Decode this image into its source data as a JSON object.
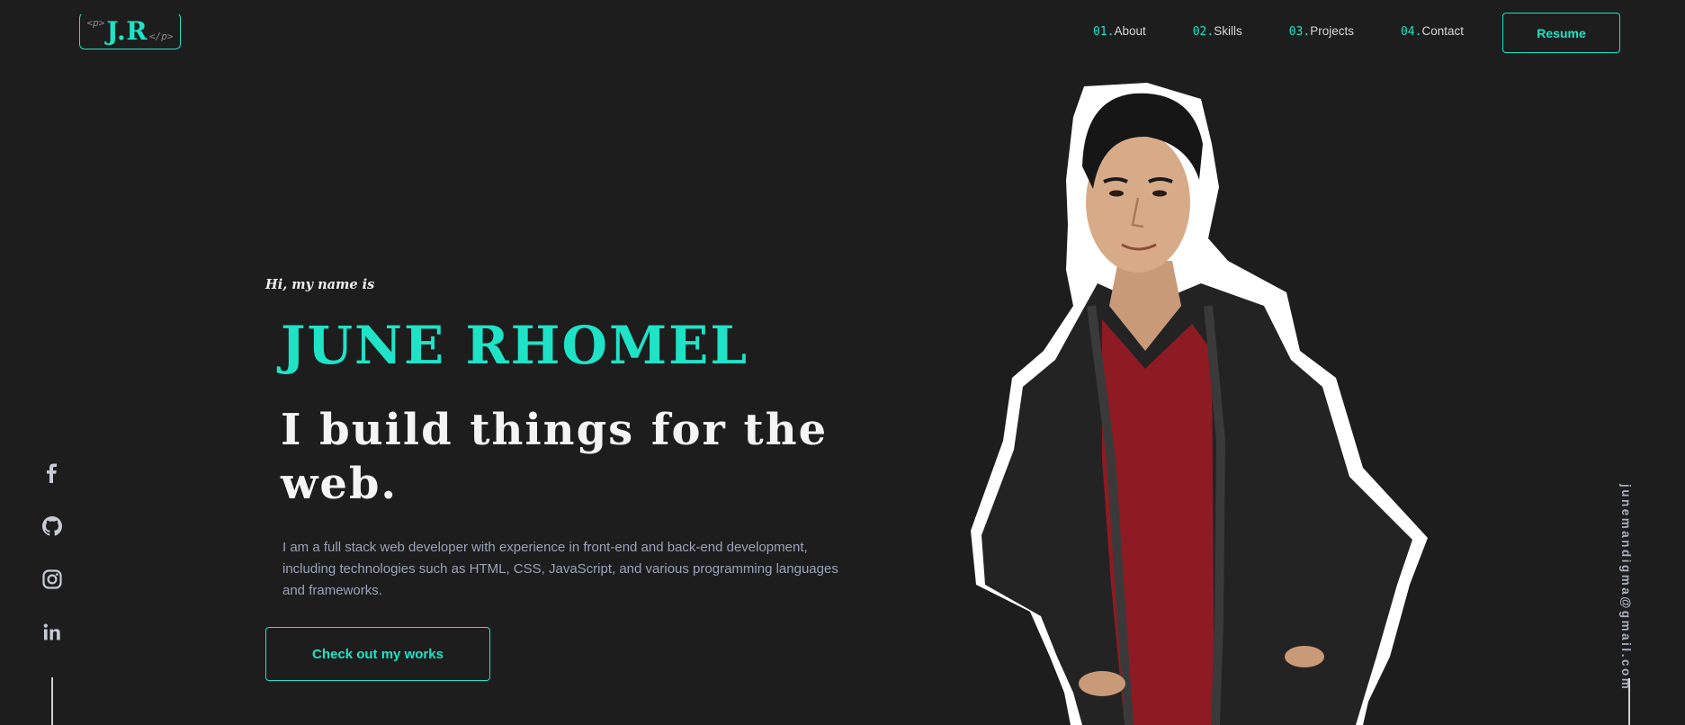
{
  "header": {
    "logo": {
      "open_tag": "<p>",
      "mark": "J.R",
      "close_tag": "</p>"
    },
    "nav": [
      {
        "num": "01.",
        "label": "About"
      },
      {
        "num": "02.",
        "label": "Skills"
      },
      {
        "num": "03.",
        "label": "Projects"
      },
      {
        "num": "04.",
        "label": "Contact"
      }
    ],
    "resume_label": "Resume"
  },
  "hero": {
    "greeting": "Hi, my name is",
    "name": "JUNE RHOMEL",
    "tagline": "I build things for the web.",
    "bio": "I am a full stack web developer with experience in front-end and back-end development, including technologies such as HTML, CSS, JavaScript, and various programming languages and frameworks.",
    "cta_label": "Check out my works"
  },
  "socials": [
    {
      "icon": "facebook-icon"
    },
    {
      "icon": "github-icon"
    },
    {
      "icon": "instagram-icon"
    },
    {
      "icon": "linkedin-icon"
    }
  ],
  "email": "junemandigma@gmail.com",
  "colors": {
    "background": "#1d1d1d",
    "accent": "#1ee3c7",
    "body_text": "#9aa2b8"
  }
}
